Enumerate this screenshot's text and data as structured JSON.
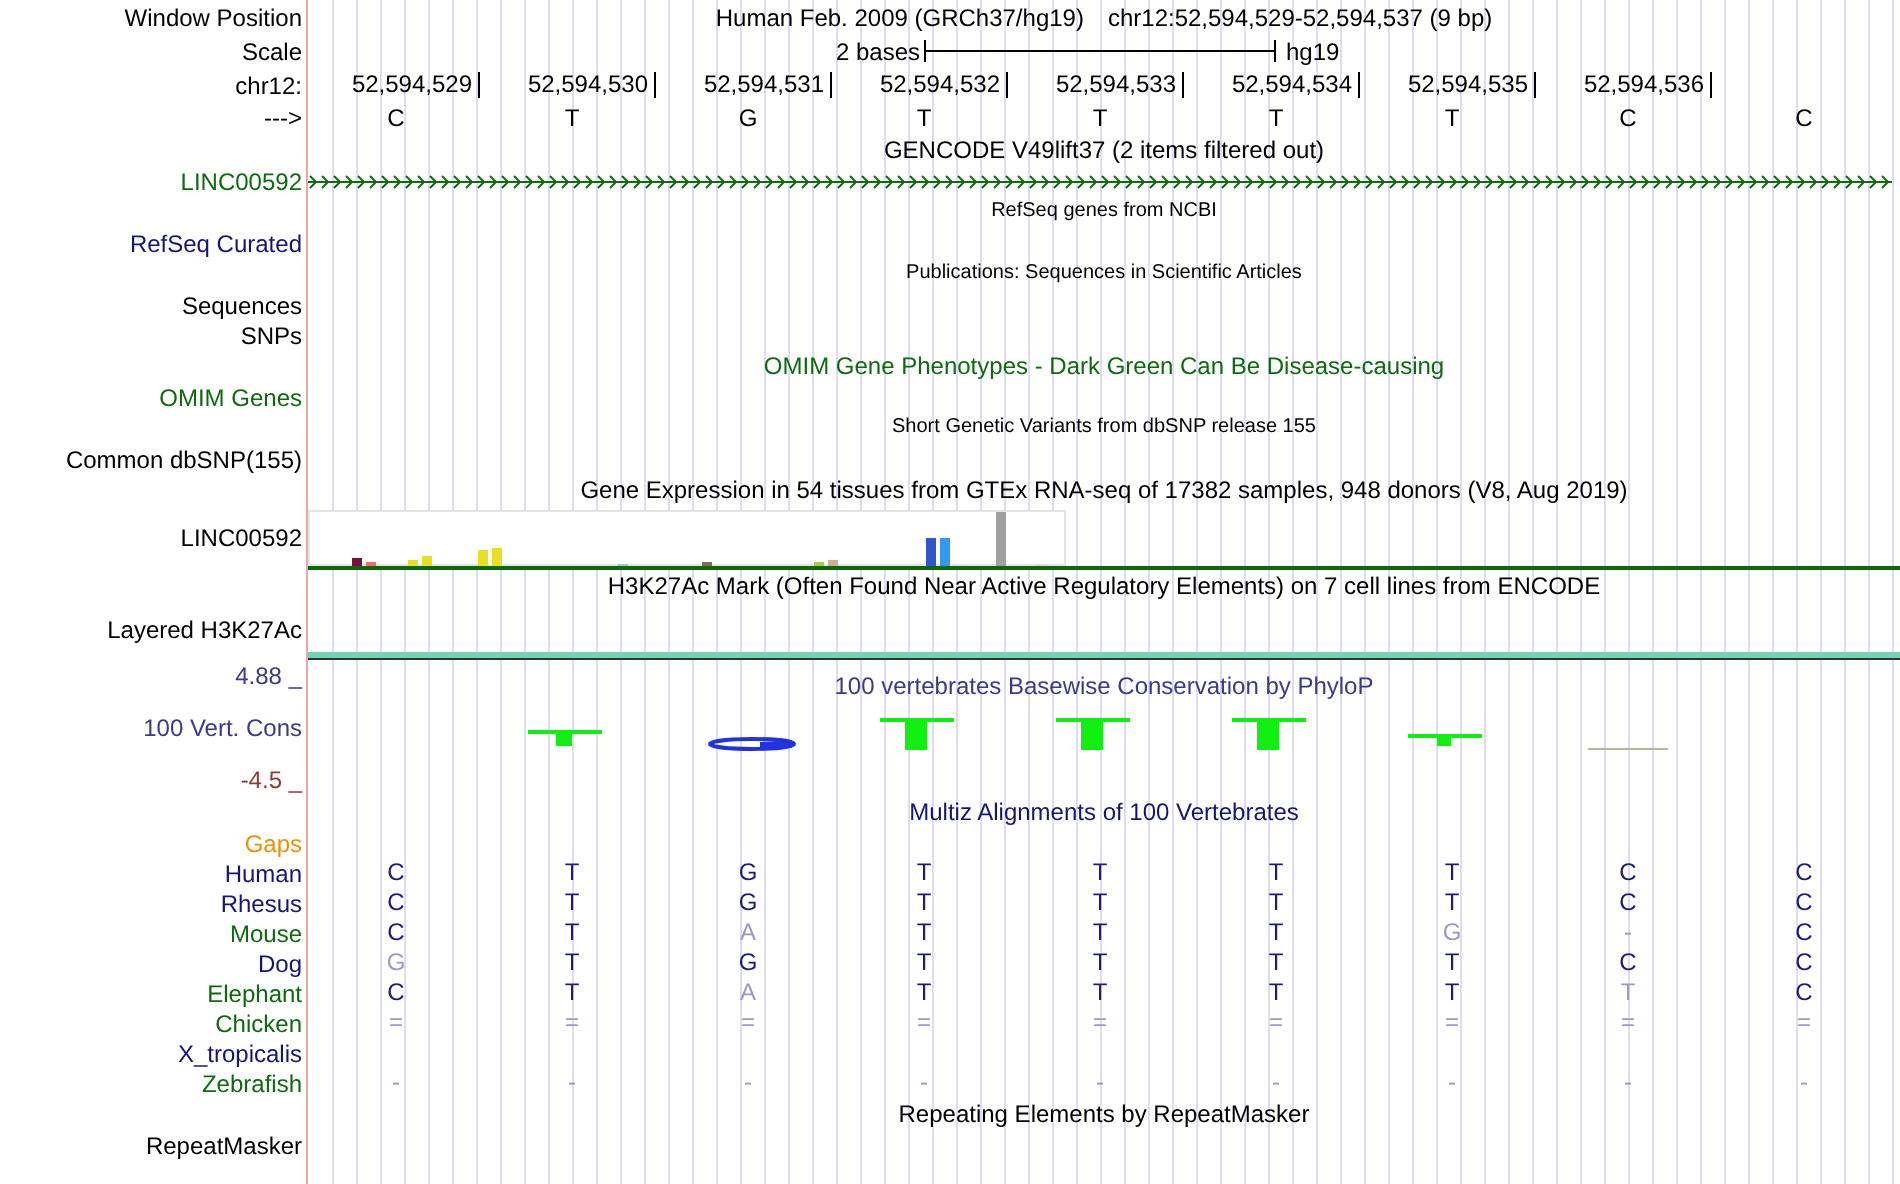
{
  "header": {
    "labels": [
      "Window Position",
      "Scale",
      "chr12:",
      "--->"
    ],
    "title": "Human Feb. 2009 (GRCh37/hg19)",
    "position": "chr12:52,594,529-52,594,537 (9 bp)",
    "scale_text": "2 bases",
    "assembly": "hg19",
    "ticks": [
      "52,594,529",
      "52,594,530",
      "52,594,531",
      "52,594,532",
      "52,594,533",
      "52,594,534",
      "52,594,535",
      "52,594,536"
    ],
    "bases": [
      "C",
      "T",
      "G",
      "T",
      "T",
      "T",
      "T",
      "C",
      "C"
    ]
  },
  "tracks": [
    {
      "kind": "title",
      "text": "GENCODE V49lift37 (2 items filtered out)",
      "color": "#000000"
    },
    {
      "kind": "gene",
      "label": "LINC00592",
      "color": "#0d6b0d"
    },
    {
      "kind": "note",
      "text": "RefSeq genes from NCBI",
      "color": "#000000"
    },
    {
      "kind": "label",
      "label": "RefSeq Curated",
      "color": "#14147a"
    },
    {
      "kind": "note",
      "text": "Publications: Sequences in Scientific Articles",
      "color": "#000000"
    },
    {
      "kind": "label",
      "label": "Sequences",
      "color": "#000000"
    },
    {
      "kind": "label",
      "label": "SNPs",
      "color": "#000000"
    },
    {
      "kind": "title",
      "text": "OMIM Gene Phenotypes - Dark Green Can Be Disease-causing",
      "color": "#0d6b0d"
    },
    {
      "kind": "label",
      "label": "OMIM Genes",
      "color": "#0d6b0d"
    },
    {
      "kind": "note",
      "text": "Short Genetic Variants from dbSNP release 155",
      "color": "#000000"
    },
    {
      "kind": "label",
      "label": "Common dbSNP(155)",
      "color": "#000000"
    },
    {
      "kind": "title",
      "text": "Gene Expression in 54 tissues from GTEx RNA-seq of 17382 samples, 948 donors (V8, Aug 2019)",
      "color": "#000000"
    },
    {
      "kind": "expression",
      "label": "LINC00592",
      "color": "#000000"
    },
    {
      "kind": "title",
      "text": "H3K27Ac Mark (Often Found Near Active Regulatory Elements) on 7 cell lines from ENCODE",
      "color": "#000000"
    },
    {
      "kind": "mark",
      "label": "Layered H3K27Ac",
      "color": "#000000"
    },
    {
      "kind": "conservation",
      "label": "100 Vert. Cons",
      "color": "#3a3a8c",
      "max": "4.88 _",
      "min": "-4.5 _",
      "text": "100 vertebrates Basewise Conservation by PhyloP"
    },
    {
      "kind": "title",
      "text": "Multiz Alignments of 100 Vertebrates",
      "color": "#14147a"
    },
    {
      "kind": "label",
      "label": "Gaps",
      "color": "#e8900a"
    },
    {
      "kind": "species",
      "label": "Human",
      "color": "#14147a",
      "bases": [
        {
          "text": "C",
          "faded": false
        },
        {
          "text": "T",
          "faded": false
        },
        {
          "text": "G",
          "faded": false
        },
        {
          "text": "T",
          "faded": false
        },
        {
          "text": "T",
          "faded": false
        },
        {
          "text": "T",
          "faded": false
        },
        {
          "text": "T",
          "faded": false
        },
        {
          "text": "C",
          "faded": false
        },
        {
          "text": "C",
          "faded": false
        }
      ]
    },
    {
      "kind": "species",
      "label": "Rhesus",
      "color": "#14147a",
      "bases": [
        {
          "text": "C",
          "faded": false
        },
        {
          "text": "T",
          "faded": false
        },
        {
          "text": "G",
          "faded": false
        },
        {
          "text": "T",
          "faded": false
        },
        {
          "text": "T",
          "faded": false
        },
        {
          "text": "T",
          "faded": false
        },
        {
          "text": "T",
          "faded": false
        },
        {
          "text": "C",
          "faded": false
        },
        {
          "text": "C",
          "faded": false
        }
      ]
    },
    {
      "kind": "species",
      "label": "Mouse",
      "color": "#0d6b0d",
      "bases": [
        {
          "text": "C",
          "faded": false
        },
        {
          "text": "T",
          "faded": false
        },
        {
          "text": "A",
          "faded": true
        },
        {
          "text": "T",
          "faded": false
        },
        {
          "text": "T",
          "faded": false
        },
        {
          "text": "T",
          "faded": false
        },
        {
          "text": "G",
          "faded": true
        },
        {
          "text": "-",
          "faded": true
        },
        {
          "text": "C",
          "faded": false
        }
      ]
    },
    {
      "kind": "species",
      "label": "Dog",
      "color": "#14147a",
      "bases": [
        {
          "text": "G",
          "faded": true
        },
        {
          "text": "T",
          "faded": false
        },
        {
          "text": "G",
          "faded": false
        },
        {
          "text": "T",
          "faded": false
        },
        {
          "text": "T",
          "faded": false
        },
        {
          "text": "T",
          "faded": false
        },
        {
          "text": "T",
          "faded": false
        },
        {
          "text": "C",
          "faded": false
        },
        {
          "text": "C",
          "faded": false
        }
      ]
    },
    {
      "kind": "species",
      "label": "Elephant",
      "color": "#0d6b0d",
      "bases": [
        {
          "text": "C",
          "faded": false
        },
        {
          "text": "T",
          "faded": false
        },
        {
          "text": "A",
          "faded": true
        },
        {
          "text": "T",
          "faded": false
        },
        {
          "text": "T",
          "faded": false
        },
        {
          "text": "T",
          "faded": false
        },
        {
          "text": "T",
          "faded": false
        },
        {
          "text": "T",
          "faded": true
        },
        {
          "text": "C",
          "faded": false
        }
      ]
    },
    {
      "kind": "species",
      "label": "Chicken",
      "color": "#0d6b0d",
      "bases": [
        {
          "text": "=",
          "faded": true
        },
        {
          "text": "=",
          "faded": true
        },
        {
          "text": "=",
          "faded": true
        },
        {
          "text": "=",
          "faded": true
        },
        {
          "text": "=",
          "faded": true
        },
        {
          "text": "=",
          "faded": true
        },
        {
          "text": "=",
          "faded": true
        },
        {
          "text": "=",
          "faded": true
        },
        {
          "text": "=",
          "faded": true
        }
      ]
    },
    {
      "kind": "species",
      "label": "X_tropicalis",
      "color": "#14147a"
    },
    {
      "kind": "species",
      "label": "Zebrafish",
      "color": "#0d6b0d",
      "bases": [
        {
          "text": "-",
          "faded": true
        },
        {
          "text": "-",
          "faded": true
        },
        {
          "text": "-",
          "faded": true
        },
        {
          "text": "-",
          "faded": true
        },
        {
          "text": "-",
          "faded": true
        },
        {
          "text": "-",
          "faded": true
        },
        {
          "text": "-",
          "faded": true
        },
        {
          "text": "-",
          "faded": true
        },
        {
          "text": "-",
          "faded": true
        }
      ]
    },
    {
      "kind": "title",
      "text": "Repeating Elements by RepeatMasker",
      "color": "#000000"
    },
    {
      "kind": "label",
      "label": "RepeatMasker",
      "color": "#000000"
    }
  ]
}
